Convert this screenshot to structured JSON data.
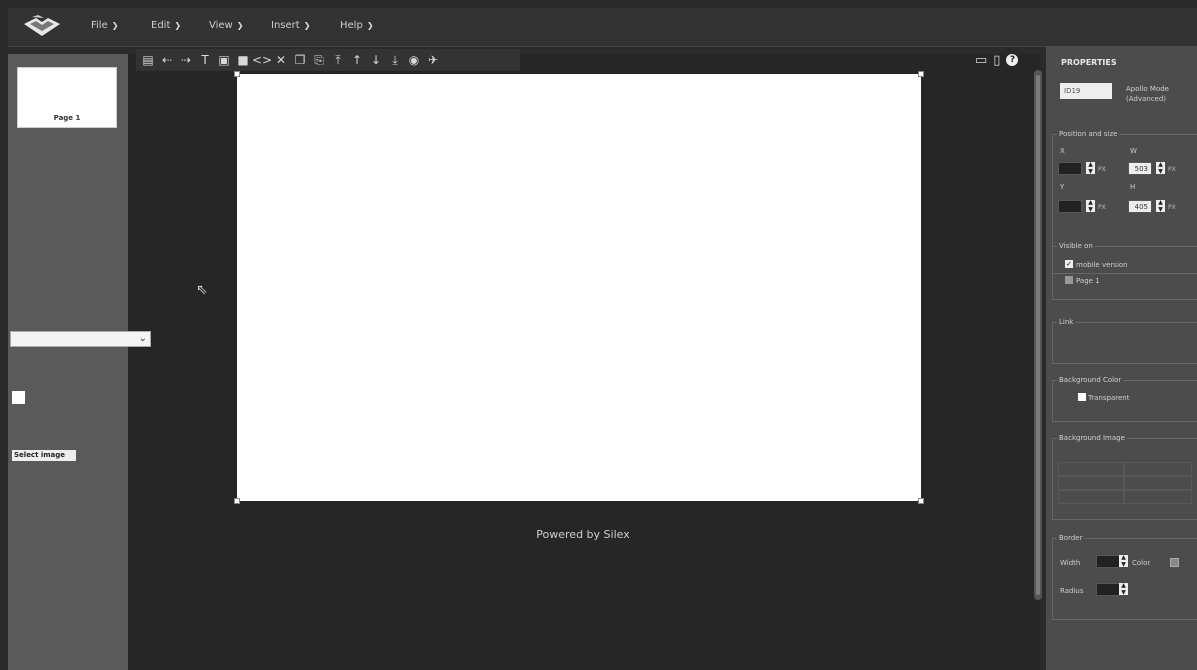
{
  "menu": [
    {
      "label": "File"
    },
    {
      "label": "Edit"
    },
    {
      "label": "View"
    },
    {
      "label": "Insert"
    },
    {
      "label": "Help"
    }
  ],
  "pages": [
    {
      "label": "Page 1"
    }
  ],
  "toolbar": {
    "icons": [
      "save-icon",
      "undo-icon",
      "redo-icon",
      "text-icon",
      "image-icon",
      "container-icon",
      "html-icon",
      "delete-icon",
      "copy-icon",
      "paste-icon",
      "move-top-icon",
      "move-up-icon",
      "move-down-icon",
      "move-bottom-icon",
      "preview-icon",
      "publish-icon"
    ]
  },
  "stage": {
    "footer": "Powered by Silex"
  },
  "properties": {
    "title": "PROPERTIES",
    "id_value": "ID19",
    "mode_text": "Apollo Mode (Advanced)",
    "position": {
      "legend": "Position and size",
      "x_label": "X",
      "x_value": "",
      "w_label": "W",
      "w_value": "503",
      "y_label": "Y",
      "y_value": "",
      "h_label": "H",
      "h_value": "405",
      "unit": "PX"
    },
    "visible": {
      "legend": "Visible on",
      "mobile_label": "mobile version",
      "mobile_checked": true,
      "page_label": "Page 1",
      "page_checked": false
    },
    "link": {
      "legend": "Link",
      "value": ""
    },
    "background_color": {
      "legend": "Background Color",
      "transparent_label": "Transparent",
      "swatch": "#ffffff"
    },
    "background_image": {
      "legend": "Background Image",
      "button": "Select image"
    },
    "border": {
      "legend": "Border",
      "width_label": "Width",
      "color_label": "Color",
      "radius_label": "Radius"
    }
  }
}
